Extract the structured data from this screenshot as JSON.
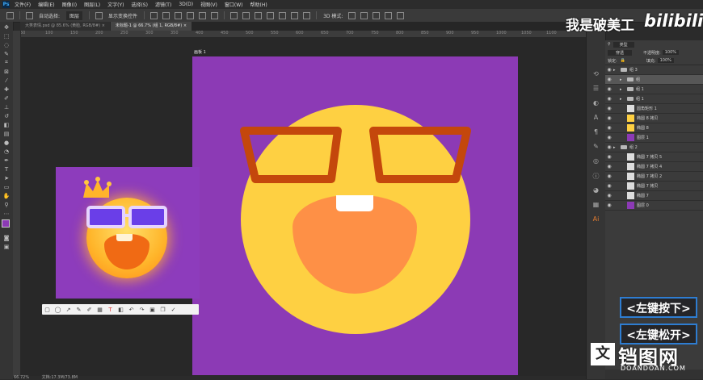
{
  "menubar": {
    "app_icon": "Ps",
    "items": [
      "文件(F)",
      "编辑(E)",
      "图像(I)",
      "图层(L)",
      "文字(Y)",
      "选择(S)",
      "滤镜(T)",
      "3D(D)",
      "视图(V)",
      "窗口(W)",
      "帮助(H)"
    ]
  },
  "options_bar": {
    "auto_select_label": "自动选择:",
    "auto_select_value": "图层",
    "show_transform_label": "显示变换控件"
  },
  "tabs": [
    {
      "label": "大笑表情.psd @ 85.6% (黄脸, RGB/8#)",
      "active": false
    },
    {
      "label": "未标题-1 @ 66.7% (组 1, RGB/8#)",
      "active": true
    }
  ],
  "ruler": {
    "ticks": [
      "50",
      "100",
      "150",
      "200",
      "250",
      "300",
      "350",
      "400",
      "450",
      "500",
      "550",
      "600",
      "650",
      "700",
      "750",
      "800",
      "850",
      "900",
      "950",
      "1000",
      "1050",
      "1100"
    ]
  },
  "canvas": {
    "artboard_label": "画板 1",
    "background_color": "#8c3ab5",
    "face_color": "#fed042",
    "glasses_color": "#c4470c",
    "mouth_color": "#fe9046",
    "tooth_color": "#ffffff"
  },
  "layers_panel": {
    "kind_label": "类型",
    "blend_mode": "穿透",
    "opacity_label": "不透明度:",
    "opacity_value": "100%",
    "lock_label": "锁定:",
    "fill_label": "填充:",
    "fill_value": "100%",
    "layers": [
      {
        "name": "组 3",
        "type": "group",
        "indent": 0,
        "selected": false
      },
      {
        "name": "组",
        "type": "group",
        "indent": 1,
        "selected": true
      },
      {
        "name": "组 1",
        "type": "group",
        "indent": 1,
        "selected": false
      },
      {
        "name": "组 1",
        "type": "group",
        "indent": 1,
        "selected": false
      },
      {
        "name": "圆角矩形 1",
        "type": "shape",
        "indent": 1,
        "selected": false
      },
      {
        "name": "椭圆 8 拷贝",
        "type": "shape",
        "indent": 1,
        "selected": false
      },
      {
        "name": "椭圆 8",
        "type": "shape",
        "indent": 1,
        "selected": false
      },
      {
        "name": "图层 1",
        "type": "fill",
        "indent": 1,
        "selected": false
      },
      {
        "name": "组 2",
        "type": "group",
        "indent": 0,
        "selected": false
      },
      {
        "name": "椭圆 7 拷贝 5",
        "type": "shape",
        "indent": 1,
        "selected": false
      },
      {
        "name": "椭圆 7 拷贝 4",
        "type": "shape",
        "indent": 1,
        "selected": false
      },
      {
        "name": "椭圆 7 拷贝 2",
        "type": "shape",
        "indent": 1,
        "selected": false
      },
      {
        "name": "椭圆 7 拷贝",
        "type": "shape",
        "indent": 1,
        "selected": false
      },
      {
        "name": "椭圆 7",
        "type": "shape",
        "indent": 1,
        "selected": false
      },
      {
        "name": "图层 0",
        "type": "fill",
        "indent": 1,
        "selected": false
      }
    ]
  },
  "overlays": {
    "watermark_text": "我是破美工",
    "bilibili_text": "bilibili",
    "left_press_hint": "<左键按下>",
    "left_release_hint": "<左键松开>",
    "site_logo_text": "铛图网",
    "site_logo_icon": "文",
    "site_sub_text": "DOANDOAN.COM"
  },
  "status": {
    "zoom": "66.72%",
    "doc_info": "文档:17.3M/73.8M"
  },
  "colors": {
    "foreground": "#8c3ab5",
    "background": "#ffffff",
    "accent_hint_border": "#2e7dd2"
  }
}
